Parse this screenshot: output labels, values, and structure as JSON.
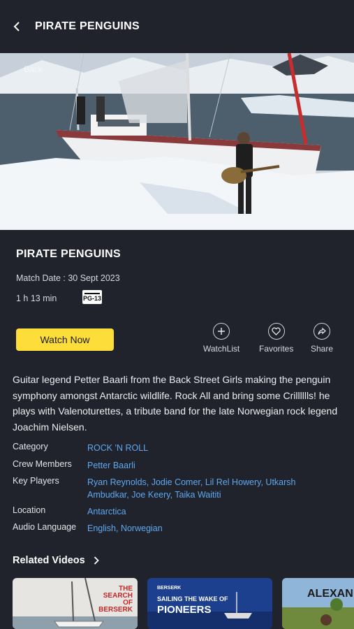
{
  "header": {
    "title": "PIRATE PENGUINS"
  },
  "hero": {
    "overlay_text": "Back"
  },
  "details": {
    "title": "PIRATE PENGUINS",
    "match_date": "Match Date : 30 Sept 2023",
    "duration": "1 h 13 min",
    "rating": "PG-13"
  },
  "actions": {
    "watch_now": "Watch Now",
    "watchlist": "WatchList",
    "favorites": "Favorites",
    "share": "Share"
  },
  "description": "Guitar legend Petter Baarli from the Back Street Girls making the penguin symphony amongst Antarctic wildlife. Rock All and bring some Crilllllls! he plays with Valenoturettes, a tribute band for the late Norwegian rock legend Joachim  Nielsen.",
  "meta": [
    {
      "label": "Category",
      "value": "ROCK 'N ROLL"
    },
    {
      "label": "Crew Members",
      "value": "Petter Baarli"
    },
    {
      "label": "Key Players",
      "value": "Ryan Reynolds, Jodie Comer, Lil Rel Howery, Utkarsh Ambudkar, Joe Keery, Taika Waititi"
    },
    {
      "label": "Location",
      "value": "Antarctica"
    },
    {
      "label": "Audio Language",
      "value": "English, Norwegian"
    }
  ],
  "related": {
    "title": "Related Videos",
    "items": [
      {
        "line1": "THE",
        "line2": "SEARCH",
        "line3": "OF",
        "line4": "BERSERK"
      },
      {
        "tag": "BERSERK",
        "line1": "SAILING THE WAKE OF",
        "line2": "PIONEERS"
      },
      {
        "line1": "ALEXAN"
      }
    ]
  },
  "colors": {
    "background": "#20232b",
    "accent": "#fddd3a",
    "link": "#5fa8f0"
  }
}
